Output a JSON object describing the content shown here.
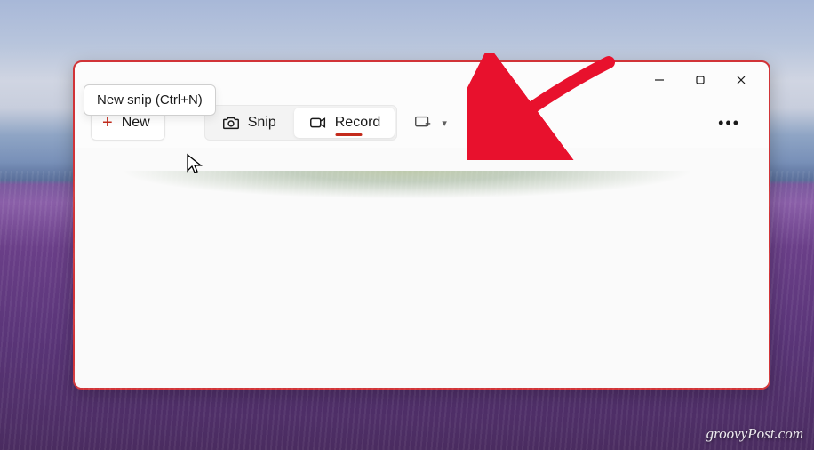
{
  "tooltip": {
    "text": "New snip (Ctrl+N)"
  },
  "toolbar": {
    "new_label": "New",
    "snip_label": "Snip",
    "record_label": "Record"
  },
  "watermark": "groovyPost.com",
  "colors": {
    "accent": "#c42b1c",
    "border": "#d13438"
  }
}
